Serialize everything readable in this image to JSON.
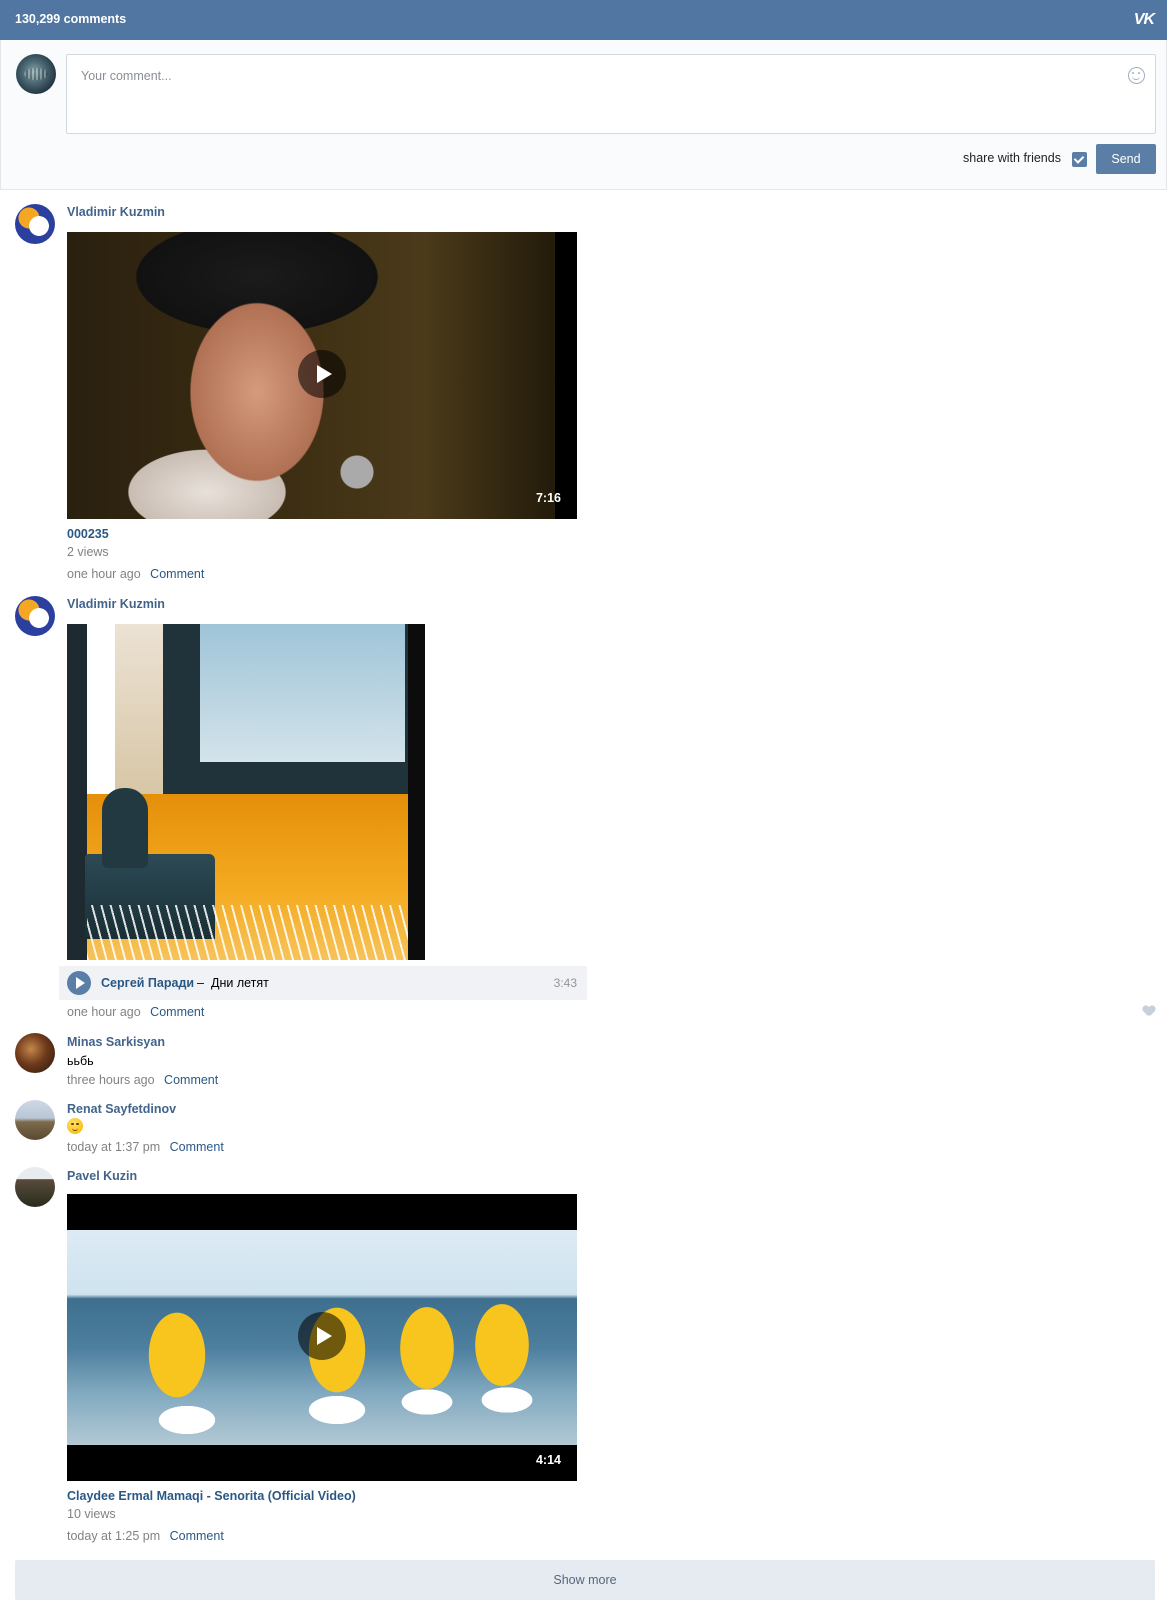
{
  "header": {
    "comments_count": "130,299 comments",
    "logo": "VK"
  },
  "composer": {
    "placeholder": "Your comment...",
    "share_label": "share with friends",
    "share_checked": true,
    "send_label": "Send"
  },
  "posts": [
    {
      "author": "Vladimir Kuzmin",
      "video": {
        "duration": "7:16",
        "title": "000235",
        "views": "2 views"
      },
      "time": "one hour ago",
      "comment_label": "Comment"
    },
    {
      "author": "Vladimir Kuzmin",
      "audio": {
        "artist": "Сергей Паради",
        "separator": "–",
        "title": "Дни летят",
        "duration": "3:43"
      },
      "time": "one hour ago",
      "comment_label": "Comment"
    },
    {
      "author": "Minas Sarkisyan",
      "text": "ььбь",
      "time": "three hours ago",
      "comment_label": "Comment"
    },
    {
      "author": "Renat Sayfetdinov",
      "emoji": "wink-emoji",
      "time": "today at 1:37 pm",
      "comment_label": "Comment"
    },
    {
      "author": "Pavel Kuzin",
      "video": {
        "duration": "4:14",
        "title": "Claydee Ermal Mamaqi - Senorita (Official Video)",
        "views": "10 views"
      },
      "time": "today at 1:25 pm",
      "comment_label": "Comment"
    }
  ],
  "show_more_label": "Show more",
  "colors": {
    "header_bg": "#5076a1",
    "link": "#2a5885",
    "author": "#42648b",
    "button": "#5b7ea6"
  }
}
